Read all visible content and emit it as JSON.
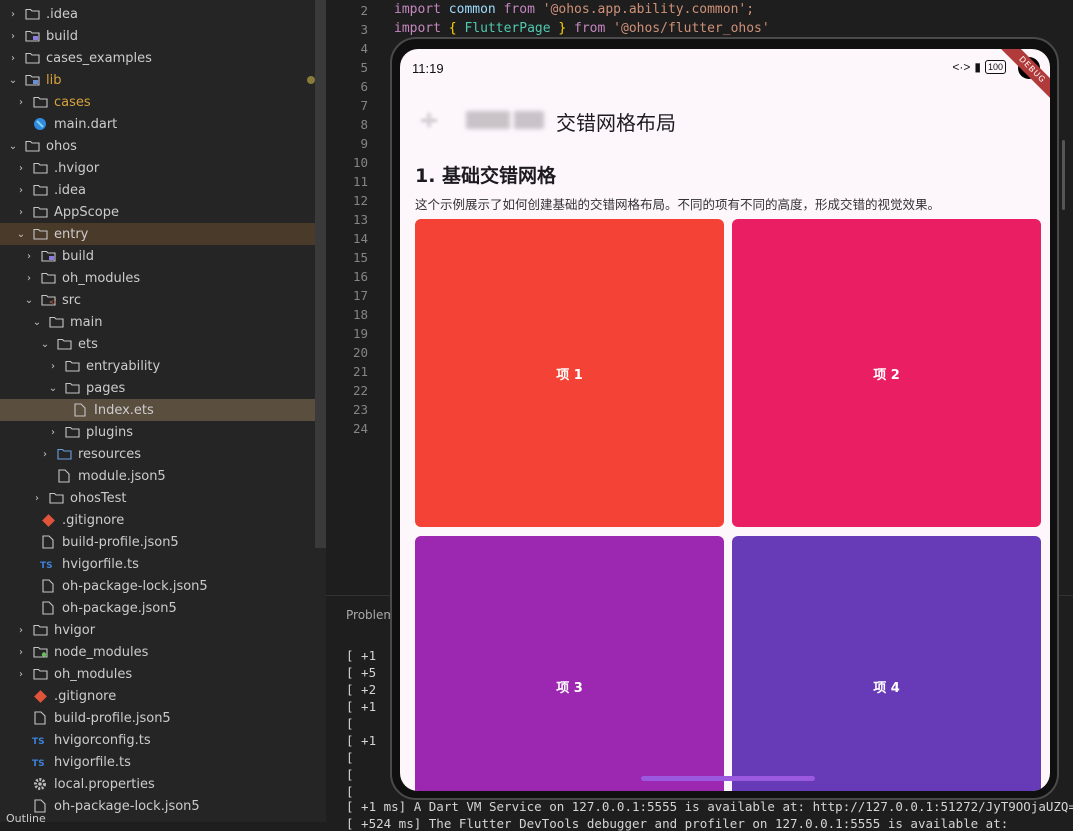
{
  "explorer": {
    "items": [
      {
        "label": ".idea",
        "chevron": "›",
        "icon": "folder",
        "indent": 1
      },
      {
        "label": "build",
        "chevron": "›",
        "icon": "folder-build",
        "indent": 1
      },
      {
        "label": "cases_examples",
        "chevron": "›",
        "icon": "folder",
        "indent": 1
      },
      {
        "label": "lib",
        "chevron": "⌄",
        "icon": "folder-lib",
        "indent": 1,
        "modified": true
      },
      {
        "label": "cases",
        "chevron": "›",
        "icon": "folder",
        "indent": 2,
        "modified": true
      },
      {
        "label": "main.dart",
        "chevron": "",
        "icon": "dart",
        "indent": 2
      },
      {
        "label": "ohos",
        "chevron": "⌄",
        "icon": "folder",
        "indent": 1
      },
      {
        "label": ".hvigor",
        "chevron": "›",
        "icon": "folder",
        "indent": 2
      },
      {
        "label": ".idea",
        "chevron": "›",
        "icon": "folder",
        "indent": 2
      },
      {
        "label": "AppScope",
        "chevron": "›",
        "icon": "folder",
        "indent": 2
      },
      {
        "label": "entry",
        "chevron": "⌄",
        "icon": "folder",
        "indent": 2,
        "active": true
      },
      {
        "label": "build",
        "chevron": "›",
        "icon": "folder-build",
        "indent": 3
      },
      {
        "label": "oh_modules",
        "chevron": "›",
        "icon": "folder",
        "indent": 3
      },
      {
        "label": "src",
        "chevron": "⌄",
        "icon": "folder-src",
        "indent": 3
      },
      {
        "label": "main",
        "chevron": "⌄",
        "icon": "folder",
        "indent": 4
      },
      {
        "label": "ets",
        "chevron": "⌄",
        "icon": "folder",
        "indent": 5
      },
      {
        "label": "entryability",
        "chevron": "›",
        "icon": "folder",
        "indent": 6
      },
      {
        "label": "pages",
        "chevron": "⌄",
        "icon": "folder",
        "indent": 6
      },
      {
        "label": "Index.ets",
        "chevron": "",
        "icon": "file",
        "indent": 7,
        "selected": true
      },
      {
        "label": "plugins",
        "chevron": "›",
        "icon": "folder",
        "indent": 6
      },
      {
        "label": "resources",
        "chevron": "›",
        "icon": "folder-res",
        "indent": 5
      },
      {
        "label": "module.json5",
        "chevron": "",
        "icon": "file",
        "indent": 5
      },
      {
        "label": "ohosTest",
        "chevron": "›",
        "icon": "folder",
        "indent": 4
      },
      {
        "label": ".gitignore",
        "chevron": "",
        "icon": "git",
        "indent": 3
      },
      {
        "label": "build-profile.json5",
        "chevron": "",
        "icon": "file",
        "indent": 3
      },
      {
        "label": "hvigorfile.ts",
        "chevron": "",
        "icon": "ts",
        "indent": 3
      },
      {
        "label": "oh-package-lock.json5",
        "chevron": "",
        "icon": "file",
        "indent": 3
      },
      {
        "label": "oh-package.json5",
        "chevron": "",
        "icon": "file",
        "indent": 3
      },
      {
        "label": "hvigor",
        "chevron": "›",
        "icon": "folder",
        "indent": 2
      },
      {
        "label": "node_modules",
        "chevron": "›",
        "icon": "folder-node",
        "indent": 2
      },
      {
        "label": "oh_modules",
        "chevron": "›",
        "icon": "folder",
        "indent": 2
      },
      {
        "label": ".gitignore",
        "chevron": "",
        "icon": "git",
        "indent": 2
      },
      {
        "label": "build-profile.json5",
        "chevron": "",
        "icon": "file",
        "indent": 2
      },
      {
        "label": "hvigorconfig.ts",
        "chevron": "",
        "icon": "ts",
        "indent": 2
      },
      {
        "label": "hvigorfile.ts",
        "chevron": "",
        "icon": "ts",
        "indent": 2
      },
      {
        "label": "local.properties",
        "chevron": "",
        "icon": "gear",
        "indent": 2
      },
      {
        "label": "oh-package-lock.json5",
        "chevron": "",
        "icon": "file",
        "indent": 2
      }
    ],
    "outline_label": "Outline"
  },
  "editor": {
    "line_numbers": [
      "2",
      "3",
      "4",
      "5",
      "6",
      "7",
      "8",
      "9",
      "10",
      "11",
      "12",
      "13",
      "14",
      "15",
      "16",
      "17",
      "18",
      "19",
      "20",
      "21",
      "22",
      "23",
      "24"
    ],
    "line2": {
      "kw1": "import",
      "id": "common",
      "kw2": "from",
      "str": "'@ohos.app.ability.common';"
    },
    "line3": {
      "kw1": "import",
      "ob": "{",
      "ty": "FlutterPage",
      "cb": "}",
      "kw2": "from",
      "str": "'@ohos/flutter_ohos'"
    }
  },
  "panel": {
    "tab_label": "Problem",
    "lines": [
      "[   +1",
      "[   +5",
      "[   +2",
      "[   +1",
      "[",
      "[   +1",
      "[",
      "[",
      "[",
      "[   +1 ms] A Dart VM Service on 127.0.0.1:5555 is available at: http://127.0.0.1:51272/JyT9OOjaUZQ=/",
      "[ +524 ms] The Flutter DevTools debugger and profiler on 127.0.0.1:5555 is available at:"
    ]
  },
  "phone": {
    "status_time": "11:19",
    "status_icons": [
      "<·>",
      "▮"
    ],
    "battery": "100",
    "debug_banner": "DEBUG",
    "app_title": "交错网格布局",
    "section_title": "1. 基础交错网格",
    "section_desc": "这个示例展示了如何创建基础的交错网格布局。不同的项有不同的高度，形成交错的视觉效果。",
    "tiles": [
      {
        "label": "项 1",
        "color": "#f44336"
      },
      {
        "label": "项 2",
        "color": "#e91e63"
      },
      {
        "label": "项 3",
        "color": "#9c27b0"
      },
      {
        "label": "项 4",
        "color": "#673ab7"
      }
    ]
  }
}
